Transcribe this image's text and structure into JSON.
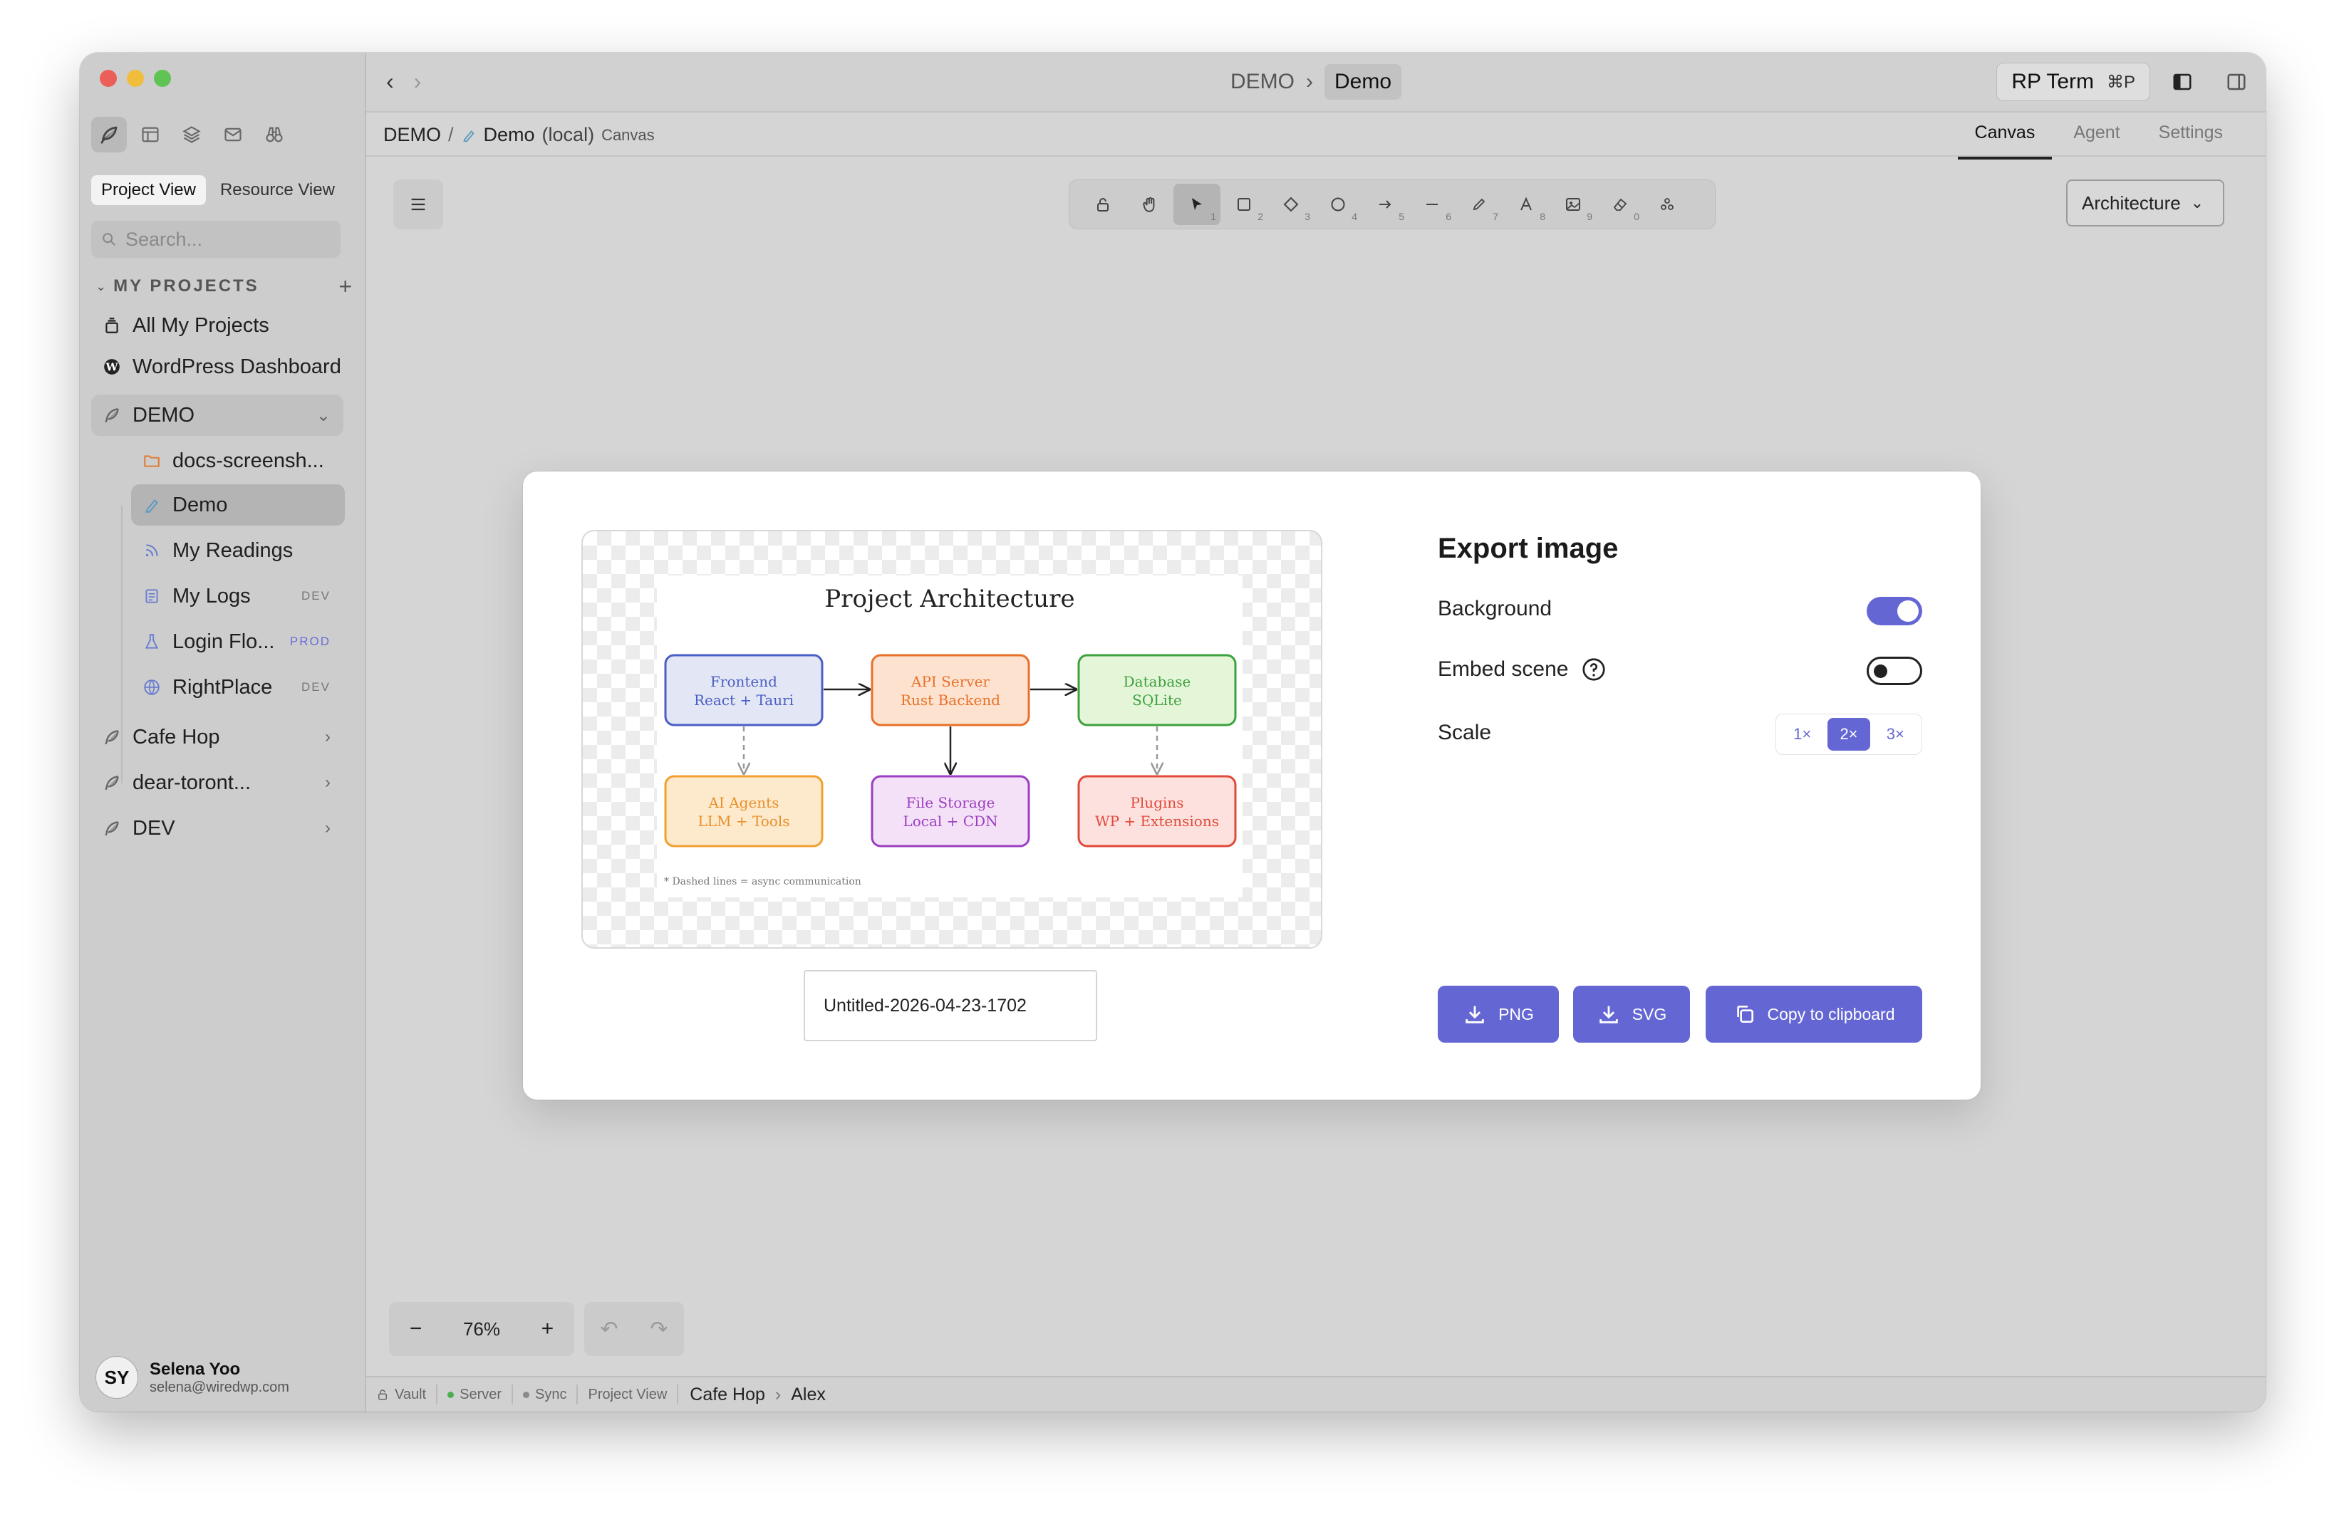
{
  "sidebar": {
    "view_tabs": [
      "Project View",
      "Resource View"
    ],
    "search_placeholder": "Search...",
    "section_title": "MY PROJECTS",
    "items": [
      {
        "label": "All My Projects"
      },
      {
        "label": "WordPress Dashboard"
      },
      {
        "label": "DEMO"
      },
      {
        "label": "docs-screensh..."
      },
      {
        "label": "Demo"
      },
      {
        "label": "My Readings"
      },
      {
        "label": "My Logs",
        "badge": "DEV"
      },
      {
        "label": "Login Flo...",
        "badge": "PROD"
      },
      {
        "label": "RightPlace",
        "badge": "DEV"
      },
      {
        "label": "Cafe Hop"
      },
      {
        "label": "dear-toront..."
      },
      {
        "label": "DEV"
      }
    ],
    "user": {
      "initials": "SY",
      "name": "Selena Yoo",
      "email": "selena@wiredwp.com"
    }
  },
  "titlebar": {
    "crumb_parent": "DEMO",
    "crumb_sep": "›",
    "crumb_current": "Demo",
    "rp_term_label": "RP Term",
    "rp_term_shortcut": "⌘P"
  },
  "subbar": {
    "path_root": "DEMO",
    "path_sep": "/",
    "path_name": "Demo",
    "path_local": "(local)",
    "path_kind": "Canvas",
    "tabs": [
      "Canvas",
      "Agent",
      "Settings"
    ],
    "active_tab": "Canvas"
  },
  "toolbar": {
    "tool_numbers": [
      "1",
      "2",
      "3",
      "4",
      "5",
      "6",
      "7",
      "8",
      "9",
      "0"
    ],
    "diagram_select": "Architecture"
  },
  "zoom": {
    "minus": "−",
    "level": "76%",
    "plus": "+"
  },
  "statusbar": {
    "vault": "Vault",
    "server": "Server",
    "sync": "Sync",
    "view": "Project View",
    "crumb_a": "Cafe Hop",
    "crumb_sep": "›",
    "crumb_b": "Alex",
    "server_color": "#4caf50",
    "sync_color": "#8a8a8a"
  },
  "export_dialog": {
    "title": "Export image",
    "background_label": "Background",
    "background_on": true,
    "embed_label": "Embed scene",
    "embed_on": false,
    "scale_label": "Scale",
    "scale_options": [
      "1×",
      "2×",
      "3×"
    ],
    "scale_selected": "2×",
    "filename": "Untitled-2026-04-23-1702",
    "buttons": {
      "png": "PNG",
      "svg": "SVG",
      "copy": "Copy to clipboard"
    },
    "accent_color": "#6466d4",
    "preview": {
      "title": "Project Architecture",
      "boxes": [
        {
          "line1": "Frontend",
          "line2": "React + Tauri",
          "stroke": "#4a5fc4",
          "fill": "#e3e6f4",
          "text": "#4a5fc4"
        },
        {
          "line1": "API Server",
          "line2": "Rust Backend",
          "stroke": "#e8702a",
          "fill": "#fde3cf",
          "text": "#e8702a"
        },
        {
          "line1": "Database",
          "line2": "SQLite",
          "stroke": "#3ea13e",
          "fill": "#e4f5d8",
          "text": "#3ea13e"
        },
        {
          "line1": "AI Agents",
          "line2": "LLM + Tools",
          "stroke": "#f0a030",
          "fill": "#fde9cc",
          "text": "#e8902a"
        },
        {
          "line1": "File Storage",
          "line2": "Local + CDN",
          "stroke": "#9c3ec0",
          "fill": "#f4e1f8",
          "text": "#9c3ec0"
        },
        {
          "line1": "Plugins",
          "line2": "WP + Extensions",
          "stroke": "#e04a3a",
          "fill": "#fde1de",
          "text": "#e04a3a"
        }
      ],
      "footnote": "* Dashed lines = async communication"
    }
  }
}
